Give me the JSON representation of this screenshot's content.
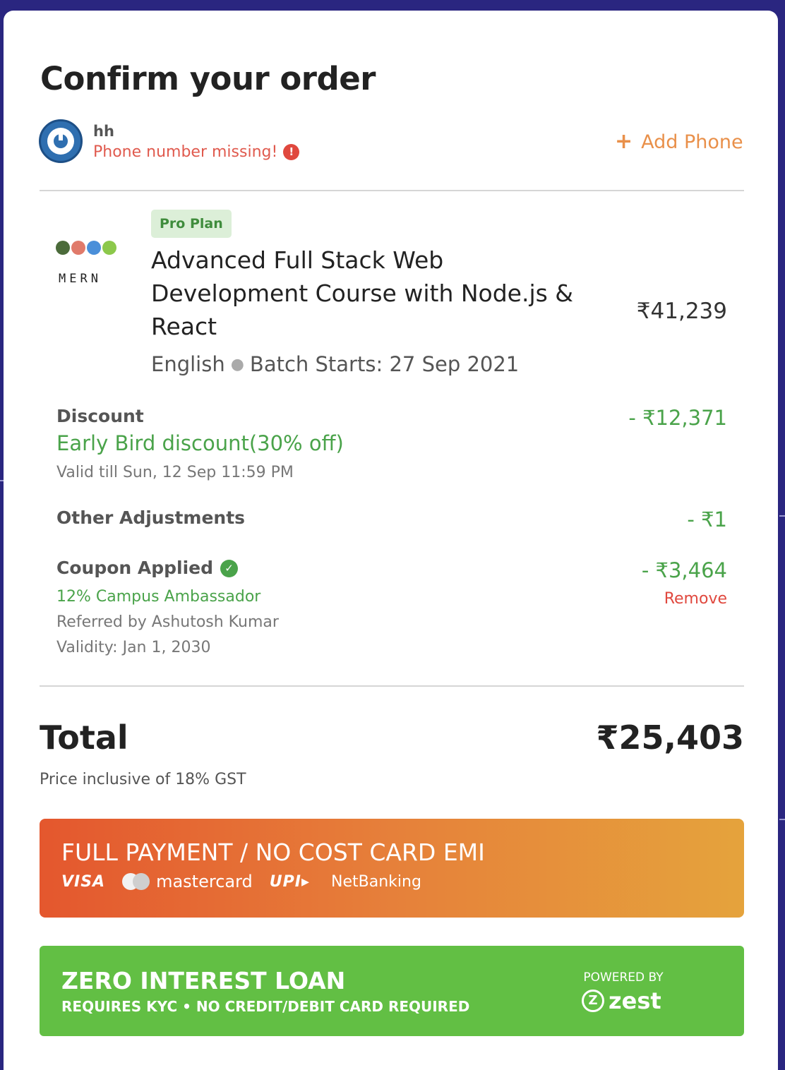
{
  "header": {
    "title": "Confirm your order"
  },
  "user": {
    "name": "hh",
    "phone_warning": "Phone number missing!",
    "add_phone_label": "Add Phone"
  },
  "course": {
    "logo_text": "MERN",
    "plan_badge": "Pro Plan",
    "title": "Advanced Full Stack Web Development Course with Node.js & React",
    "language": "English",
    "batch_label": "Batch Starts:",
    "batch_date": "27 Sep 2021",
    "price": "₹41,239"
  },
  "discount": {
    "label": "Discount",
    "name": "Early Bird discount(30% off)",
    "validity": "Valid till Sun, 12 Sep 11:59 PM",
    "amount": "- ₹12,371"
  },
  "adjustments": {
    "label": "Other Adjustments",
    "amount": "- ₹1"
  },
  "coupon": {
    "label": "Coupon Applied",
    "name": "12% Campus Ambassador",
    "referred_by": "Referred by Ashutosh Kumar",
    "validity": "Validity: Jan 1, 2030",
    "amount": "- ₹3,464",
    "remove_label": "Remove"
  },
  "total": {
    "label": "Total",
    "value": "₹25,403",
    "gst_note": "Price inclusive of 18% GST"
  },
  "full_payment": {
    "title": "FULL PAYMENT / NO COST CARD EMI",
    "methods": {
      "visa": "VISA",
      "mastercard": "mastercard",
      "upi": "UPI",
      "netbanking": "NetBanking"
    }
  },
  "loan": {
    "title": "ZERO INTEREST LOAN",
    "subtitle": "REQUIRES KYC • NO CREDIT/DEBIT CARD REQUIRED",
    "powered_by": "POWERED BY",
    "provider": "zest"
  },
  "colors": {
    "background": "#2a2680",
    "accent_orange": "#e9904a",
    "green": "#4aa34a",
    "error_red": "#e0483e",
    "loan_green": "#62bf44"
  },
  "icons": {
    "avatar": "power-avatar-icon",
    "warning": "exclamation-circle-icon",
    "add": "plus-icon",
    "coupon_ok": "check-circle-icon",
    "course_logo": "mern-stack-icon"
  }
}
